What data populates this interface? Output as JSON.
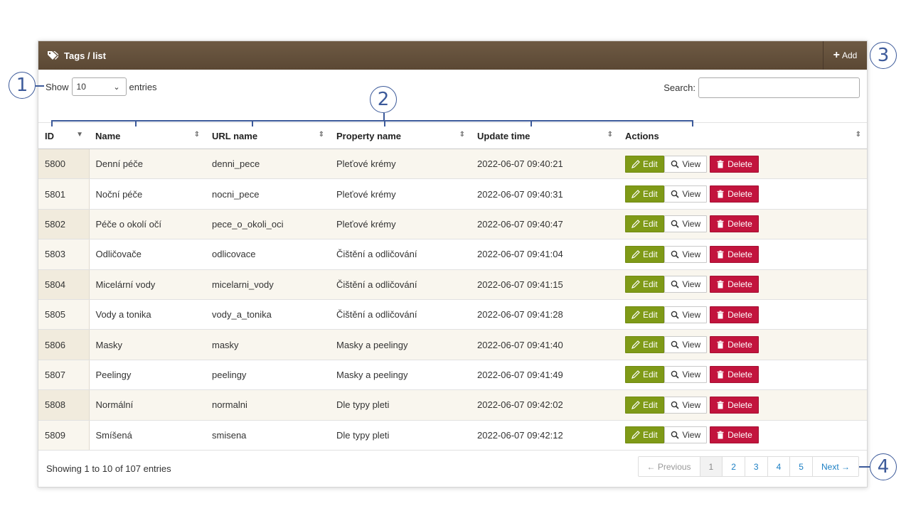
{
  "header": {
    "title": "Tags / list",
    "add_label": "Add"
  },
  "controls": {
    "show_label": "Show",
    "entries_value": "10",
    "entries_label": "entries",
    "search_label": "Search:"
  },
  "columns": [
    "ID",
    "Name",
    "URL name",
    "Property name",
    "Update time",
    "Actions"
  ],
  "rows": [
    {
      "id": "5800",
      "name": "Denní péče",
      "url": "denni_pece",
      "property": "Pleťové krémy",
      "updated": "2022-06-07 09:40:21"
    },
    {
      "id": "5801",
      "name": "Noční péče",
      "url": "nocni_pece",
      "property": "Pleťové krémy",
      "updated": "2022-06-07 09:40:31"
    },
    {
      "id": "5802",
      "name": "Péče o okolí očí",
      "url": "pece_o_okoli_oci",
      "property": "Pleťové krémy",
      "updated": "2022-06-07 09:40:47"
    },
    {
      "id": "5803",
      "name": "Odličovače",
      "url": "odlicovace",
      "property": "Čištění a odličování",
      "updated": "2022-06-07 09:41:04"
    },
    {
      "id": "5804",
      "name": "Micelární vody",
      "url": "micelarni_vody",
      "property": "Čištění a odličování",
      "updated": "2022-06-07 09:41:15"
    },
    {
      "id": "5805",
      "name": "Vody a tonika",
      "url": "vody_a_tonika",
      "property": "Čištění a odličování",
      "updated": "2022-06-07 09:41:28"
    },
    {
      "id": "5806",
      "name": "Masky",
      "url": "masky",
      "property": "Masky a peelingy",
      "updated": "2022-06-07 09:41:40"
    },
    {
      "id": "5807",
      "name": "Peelingy",
      "url": "peelingy",
      "property": "Masky a peelingy",
      "updated": "2022-06-07 09:41:49"
    },
    {
      "id": "5808",
      "name": "Normální",
      "url": "normalni",
      "property": "Dle typy pleti",
      "updated": "2022-06-07 09:42:02"
    },
    {
      "id": "5809",
      "name": "Smíšená",
      "url": "smisena",
      "property": "Dle typy pleti",
      "updated": "2022-06-07 09:42:12"
    }
  ],
  "actions": {
    "edit": "Edit",
    "view": "View",
    "delete": "Delete"
  },
  "footer": {
    "info": "Showing 1 to 10 of 107 entries",
    "previous": "← Previous",
    "pages": [
      "1",
      "2",
      "3",
      "4",
      "5"
    ],
    "next": "Next →"
  },
  "callouts": [
    "1",
    "2",
    "3",
    "4"
  ],
  "colors": {
    "header_bg": "#5f4c38",
    "edit": "#7f9a17",
    "delete": "#c2143d",
    "link": "#1b7fc4",
    "callout": "#3c5a9a"
  }
}
